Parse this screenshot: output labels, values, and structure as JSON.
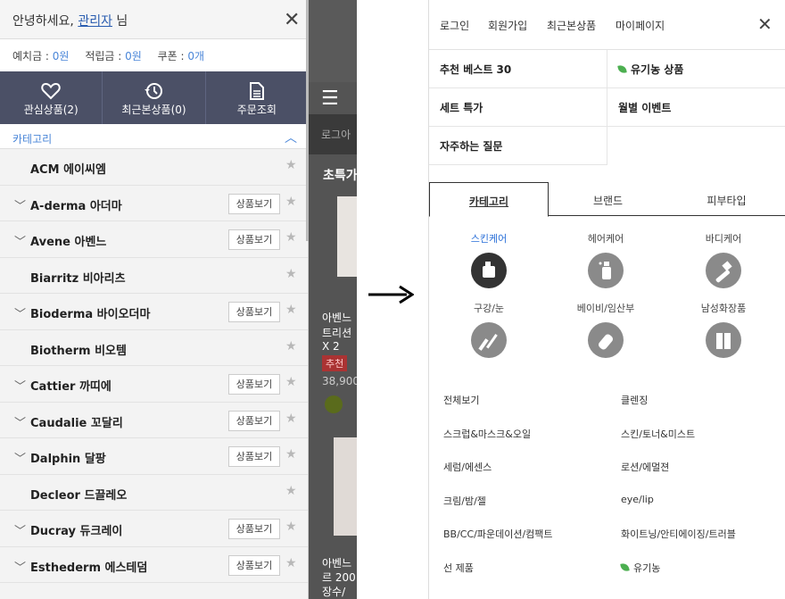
{
  "left": {
    "greeting_pre": "안녕하세요, ",
    "greeting_user": "관리자",
    "greeting_post": " 님",
    "deposit_label": "예치금 : ",
    "deposit_value": "0원",
    "points_label": "적립금 : ",
    "points_value": "0원",
    "coupon_label": "쿠폰 : ",
    "coupon_value": "0개",
    "nav": [
      {
        "label": "관심상품(2)",
        "icon": "heart-icon"
      },
      {
        "label": "최근본상품(0)",
        "icon": "history-icon"
      },
      {
        "label": "주문조회",
        "icon": "document-icon"
      }
    ],
    "category_header": "카테고리",
    "view_btn": "상품보기",
    "brands": [
      {
        "name": "ACM 에이씨엠",
        "expand": false
      },
      {
        "name": "A-derma 아더마",
        "expand": true
      },
      {
        "name": "Avene 아벤느",
        "expand": true
      },
      {
        "name": "Biarritz 비아리츠",
        "expand": false
      },
      {
        "name": "Bioderma 바이오더마",
        "expand": true
      },
      {
        "name": "Biotherm 비오템",
        "expand": false
      },
      {
        "name": "Cattier 까띠에",
        "expand": true
      },
      {
        "name": "Caudalie 꼬달리",
        "expand": true
      },
      {
        "name": "Dalphin 달팡",
        "expand": true
      },
      {
        "name": "Decleor 드끌레오",
        "expand": false
      },
      {
        "name": "Ducray 듀크레이",
        "expand": true
      },
      {
        "name": "Esthederm 에스테덤",
        "expand": true
      }
    ]
  },
  "bg": {
    "bar": "로그아",
    "title": "초특가",
    "p1a": "아벤느",
    "p1b": "트리션",
    "p1c": "X 2",
    "badge": "추천",
    "price": "38,900",
    "p2a": "아벤느",
    "p2b": "르 200",
    "p2c": "장수/"
  },
  "right": {
    "top": [
      "로그인",
      "회원가입",
      "최근본상품",
      "마이페이지"
    ],
    "menu": [
      "추천 베스트 30",
      "유기농 상품",
      "세트 특가",
      "월별 이벤트",
      "자주하는 질문"
    ],
    "tabs": [
      "카테고리",
      "브랜드",
      "피부타입"
    ],
    "icon_cats": [
      {
        "label": "스킨케어",
        "icon": "skincare-icon"
      },
      {
        "label": "헤어케어",
        "icon": "haircare-icon"
      },
      {
        "label": "바디케어",
        "icon": "bodycare-icon"
      },
      {
        "label": "구강/눈",
        "icon": "oral-eye-icon"
      },
      {
        "label": "베이비/임산부",
        "icon": "baby-icon"
      },
      {
        "label": "남성화장품",
        "icon": "men-icon"
      }
    ],
    "subcats": [
      "전체보기",
      "클렌징",
      "스크럽&마스크&오일",
      "스킨/토너&미스트",
      "세럼/에센스",
      "로션/에멀젼",
      "크림/밤/젤",
      "eye/lip",
      "BB/CC/파운데이션/컴팩트",
      "화이트닝/안티에이징/트러블",
      "선 제품",
      "유기농"
    ]
  }
}
